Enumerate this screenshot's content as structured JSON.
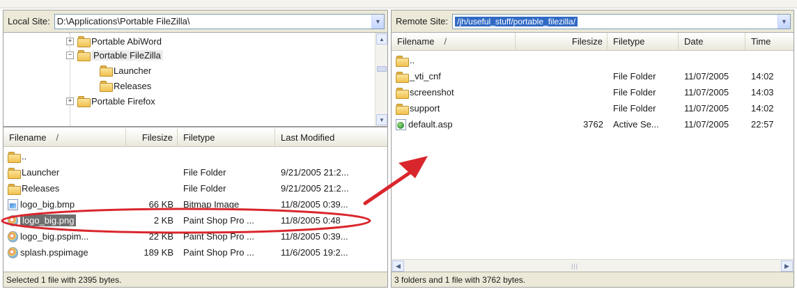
{
  "local": {
    "site_label": "Local Site:",
    "path": "D:\\Applications\\Portable FileZilla\\",
    "tree": [
      {
        "label": "Portable AbiWord",
        "toggle": "+",
        "level": 0,
        "selected": false
      },
      {
        "label": "Portable FileZilla",
        "toggle": "−",
        "level": 0,
        "selected": true
      },
      {
        "label": "Launcher",
        "toggle": "",
        "level": 1,
        "selected": false
      },
      {
        "label": "Releases",
        "toggle": "",
        "level": 1,
        "selected": false
      },
      {
        "label": "Portable Firefox",
        "toggle": "+",
        "level": 0,
        "selected": false
      }
    ],
    "columns": {
      "filename": "Filename",
      "sort": "/",
      "filesize": "Filesize",
      "filetype": "Filetype",
      "modified": "Last Modified"
    },
    "files": [
      {
        "name": "..",
        "size": "",
        "type": "",
        "modified": "",
        "icon": "folder-up-icon",
        "selected": false
      },
      {
        "name": "Launcher",
        "size": "",
        "type": "File Folder",
        "modified": "9/21/2005 21:2...",
        "icon": "folder-icon",
        "selected": false
      },
      {
        "name": "Releases",
        "size": "",
        "type": "File Folder",
        "modified": "9/21/2005 21:2...",
        "icon": "folder-icon",
        "selected": false
      },
      {
        "name": "logo_big.bmp",
        "size": "66 KB",
        "type": "Bitmap Image",
        "modified": "11/8/2005 0:39...",
        "icon": "bitmap-file-icon",
        "selected": false
      },
      {
        "name": "logo_big.png",
        "size": "2 KB",
        "type": "Paint Shop Pro ...",
        "modified": "11/8/2005 0:48",
        "icon": "paint-shop-pro-file-icon",
        "selected": true
      },
      {
        "name": "logo_big.pspim...",
        "size": "22 KB",
        "type": "Paint Shop Pro ...",
        "modified": "11/8/2005 0:39...",
        "icon": "paint-shop-pro-file-icon",
        "selected": false
      },
      {
        "name": "splash.pspimage",
        "size": "189 KB",
        "type": "Paint Shop Pro ...",
        "modified": "11/6/2005 19:2...",
        "icon": "paint-shop-pro-file-icon",
        "selected": false
      }
    ],
    "status": "Selected 1 file with 2395 bytes."
  },
  "remote": {
    "site_label": "Remote Site:",
    "path": "/jh/useful_stuff/portable_filezilla/",
    "columns": {
      "filename": "Filename",
      "sort": "/",
      "filesize": "Filesize",
      "filetype": "Filetype",
      "date": "Date",
      "time": "Time"
    },
    "files": [
      {
        "name": "..",
        "size": "",
        "type": "",
        "date": "",
        "time": "",
        "icon": "folder-up-icon"
      },
      {
        "name": "_vti_cnf",
        "size": "",
        "type": "File Folder",
        "date": "11/07/2005",
        "time": "14:02",
        "icon": "folder-icon"
      },
      {
        "name": "screenshot",
        "size": "",
        "type": "File Folder",
        "date": "11/07/2005",
        "time": "14:03",
        "icon": "folder-icon"
      },
      {
        "name": "support",
        "size": "",
        "type": "File Folder",
        "date": "11/07/2005",
        "time": "14:02",
        "icon": "folder-icon"
      },
      {
        "name": "default.asp",
        "size": "3762",
        "type": "Active Se...",
        "date": "11/07/2005",
        "time": "22:57",
        "icon": "asp-file-icon"
      }
    ],
    "status": "3 folders and 1 file with 3762 bytes."
  },
  "colors": {
    "annotation": "#d9262c",
    "selection": "#316ac5",
    "chrome": "#ece9d8"
  }
}
